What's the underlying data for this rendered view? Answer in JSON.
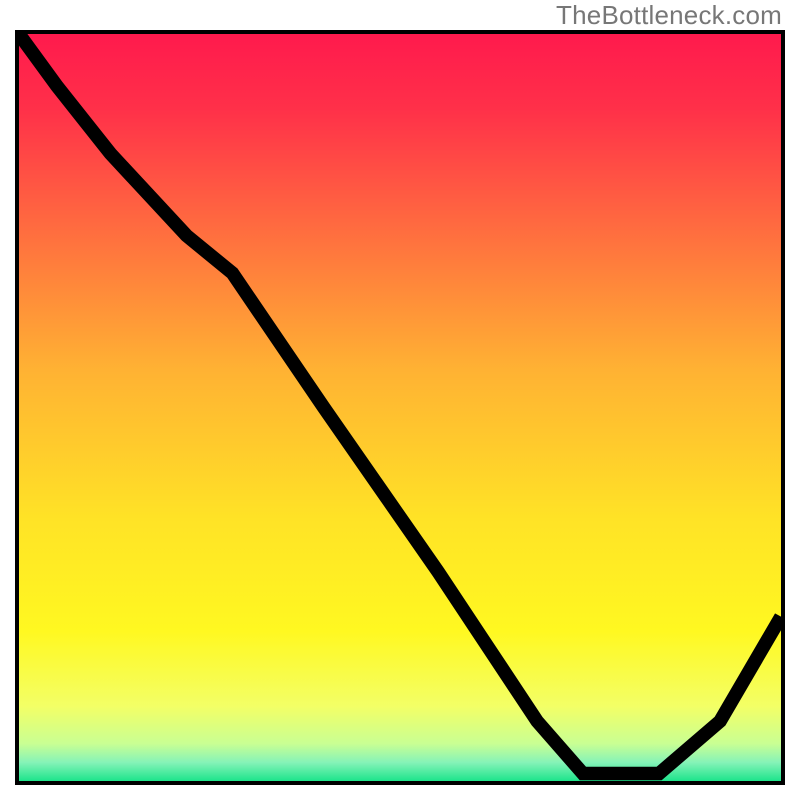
{
  "attribution": "TheBottleneck.com",
  "chart_data": {
    "type": "line",
    "title": "",
    "xlabel": "",
    "ylabel": "",
    "xlim": [
      0,
      100
    ],
    "ylim": [
      0,
      100
    ],
    "grid": false,
    "legend": false,
    "background": {
      "kind": "vertical_gradient",
      "stops": [
        {
          "pos": 0.0,
          "color": "#ff1a4d"
        },
        {
          "pos": 0.1,
          "color": "#ff3049"
        },
        {
          "pos": 0.25,
          "color": "#ff6840"
        },
        {
          "pos": 0.45,
          "color": "#ffb233"
        },
        {
          "pos": 0.65,
          "color": "#ffe326"
        },
        {
          "pos": 0.8,
          "color": "#fff821"
        },
        {
          "pos": 0.9,
          "color": "#f3ff66"
        },
        {
          "pos": 0.95,
          "color": "#c9ff93"
        },
        {
          "pos": 0.975,
          "color": "#86f3b8"
        },
        {
          "pos": 1.0,
          "color": "#1de48b"
        }
      ]
    },
    "series": [
      {
        "name": "bottleneck_curve",
        "x": [
          0,
          5,
          12,
          22,
          28,
          40,
          55,
          68,
          74,
          84,
          92,
          100
        ],
        "y": [
          100,
          93,
          84,
          73,
          68,
          50,
          28,
          8,
          1,
          1,
          8,
          22
        ],
        "_note": "x is horizontal position (0=left,100=right); y is height (0=bottom baseline, 100=top). Estimated from pixel positions; no axis ticks are drawn."
      }
    ],
    "marker": {
      "shape": "rounded_bar",
      "x_start": 74,
      "x_end": 84,
      "y": 1,
      "color": "#d97b7b"
    }
  }
}
